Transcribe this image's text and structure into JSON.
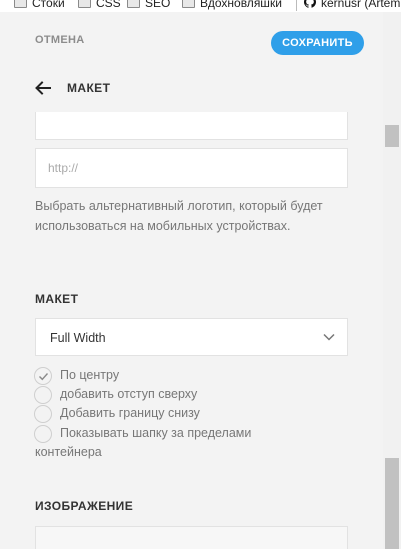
{
  "bookmarks": [
    {
      "label": "Стоки",
      "icon": "folder-icon"
    },
    {
      "label": "CSS",
      "icon": "folder-icon"
    },
    {
      "label": "SEO",
      "icon": "folder-icon"
    },
    {
      "label": "Вдохновляшки",
      "icon": "folder-icon"
    },
    {
      "label": "kernusr (Artem",
      "icon": "github-icon"
    }
  ],
  "header": {
    "cancel_label": "ОТМЕНА",
    "save_label": "СОХРАНИТЬ",
    "title": "МАКЕТ"
  },
  "logo": {
    "url_placeholder": "http://",
    "hint": "Выбрать альтернативный логотип, который будет использоваться на мобильных устройствах."
  },
  "layout": {
    "label": "МАКЕТ",
    "selected": "Full Width",
    "options": [
      {
        "label": "По центру",
        "checked": true
      },
      {
        "label": "добавить отступ сверху",
        "checked": false
      },
      {
        "label": "Добавить границу снизу",
        "checked": false
      },
      {
        "label": "Показывать шапку за пределами",
        "checked": false
      }
    ],
    "option_wrap": "контейнера"
  },
  "image": {
    "label": "ИЗОБРАЖЕНИЕ"
  },
  "colors": {
    "accent": "#2f9fe9",
    "panel_bg": "#f3f3f3"
  }
}
